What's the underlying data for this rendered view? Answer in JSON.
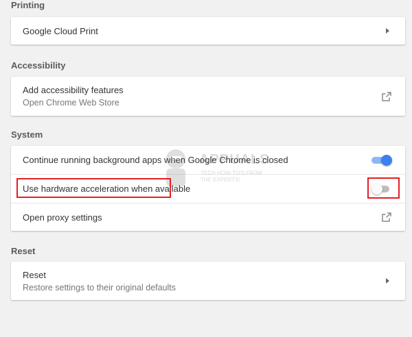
{
  "printing": {
    "title": "Printing",
    "items": [
      {
        "label": "Google Cloud Print",
        "icon": "chevron-right-icon"
      }
    ]
  },
  "accessibility": {
    "title": "Accessibility",
    "items": [
      {
        "label": "Add accessibility features",
        "sublabel": "Open Chrome Web Store",
        "icon": "external-link-icon"
      }
    ]
  },
  "system": {
    "title": "System",
    "items": [
      {
        "label": "Continue running background apps when Google Chrome is closed",
        "toggle": true
      },
      {
        "label": "Use hardware acceleration when available",
        "toggle": false
      },
      {
        "label": "Open proxy settings",
        "icon": "external-link-icon"
      }
    ]
  },
  "reset": {
    "title": "Reset",
    "items": [
      {
        "label": "Reset",
        "sublabel": "Restore settings to their original defaults",
        "icon": "chevron-right-icon"
      }
    ]
  },
  "watermark": {
    "brand": "APPUALS",
    "tagline1": "TECH HOW-TO'S FROM",
    "tagline2": "THE EXPERTS!"
  },
  "colors": {
    "background": "#f1f1f1",
    "toggle_on": "#3d7ef0",
    "highlight": "#e51c23"
  }
}
